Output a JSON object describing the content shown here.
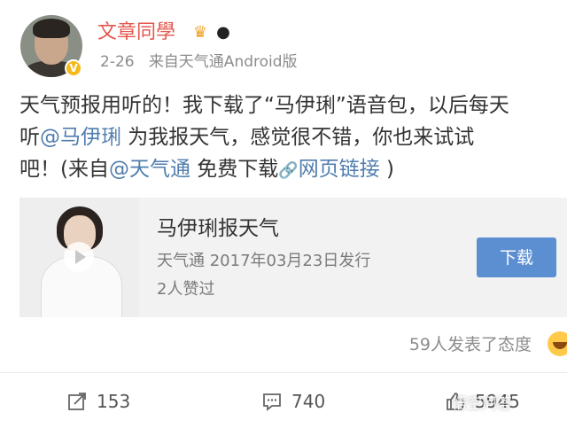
{
  "post": {
    "username": "文章同學",
    "badges": [
      "crown-icon",
      "panda-icon"
    ],
    "timestamp": "2-26",
    "source": "来自天气通Android版",
    "text": {
      "l1": "天气预报用听的！我下载了“马伊琍”语音包，以后每天",
      "l2_a": "听",
      "l2_mention": "@马伊琍",
      "l2_b": " 为我报天气，感觉很不错，你也来试试",
      "l3_a": "吧！(来自",
      "l3_mention": "@天气通",
      "l3_b": " 免费下载",
      "l3_link": "网页链接",
      "l3_c": " )"
    }
  },
  "card": {
    "title": "马伊琍报天气",
    "subtitle": "天气通 2017年03月23日发行",
    "likes": "2人赞过",
    "button": "下载"
  },
  "attitude": "59人发表了态度",
  "actions": {
    "repost": "153",
    "comment": "740",
    "like": "5945"
  },
  "watermark": "悟空问答",
  "colors": {
    "username": "#e5574e",
    "mention": "#507daf",
    "button": "#5b8fd1"
  }
}
